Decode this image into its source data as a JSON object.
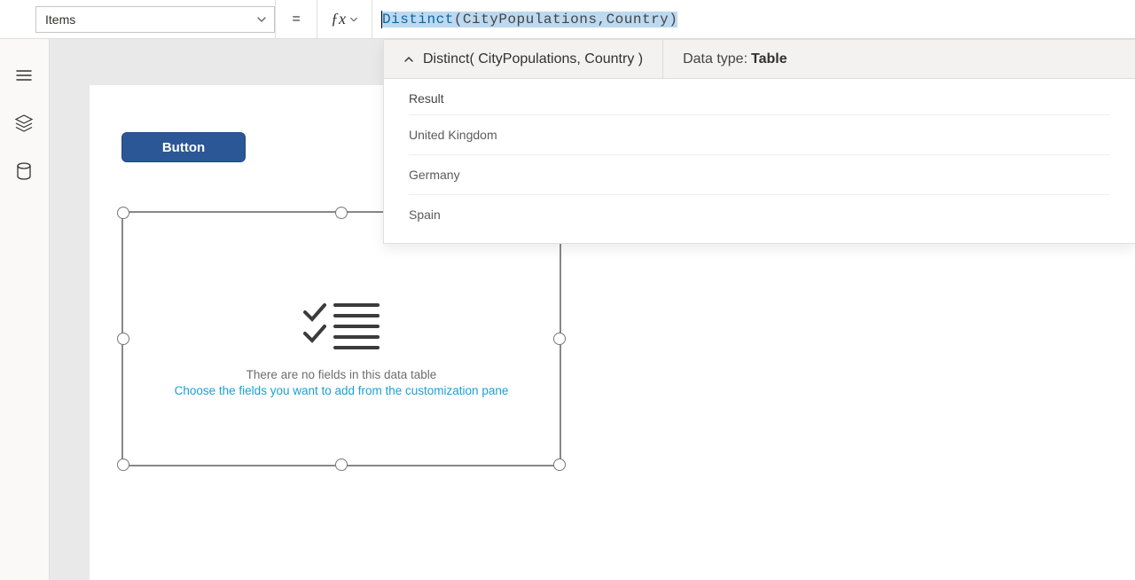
{
  "property_selector": {
    "value": "Items"
  },
  "formula": {
    "raw": "Distinct( CityPopulations, Country )",
    "func": "Distinct",
    "open": "( ",
    "arg1": "CityPopulations",
    "comma": ", ",
    "arg2": "Country ",
    "close": ")"
  },
  "result_flyout": {
    "signature": "Distinct( CityPopulations, Country )",
    "data_type_label": "Data type:",
    "data_type_value": "Table",
    "column_header": "Result",
    "rows": [
      "United Kingdom",
      "Germany",
      "Spain"
    ]
  },
  "canvas": {
    "button_label": "Button",
    "datatable": {
      "msg1": "There are no fields in this data table",
      "msg2": "Choose the fields you want to add from the customization pane"
    }
  }
}
